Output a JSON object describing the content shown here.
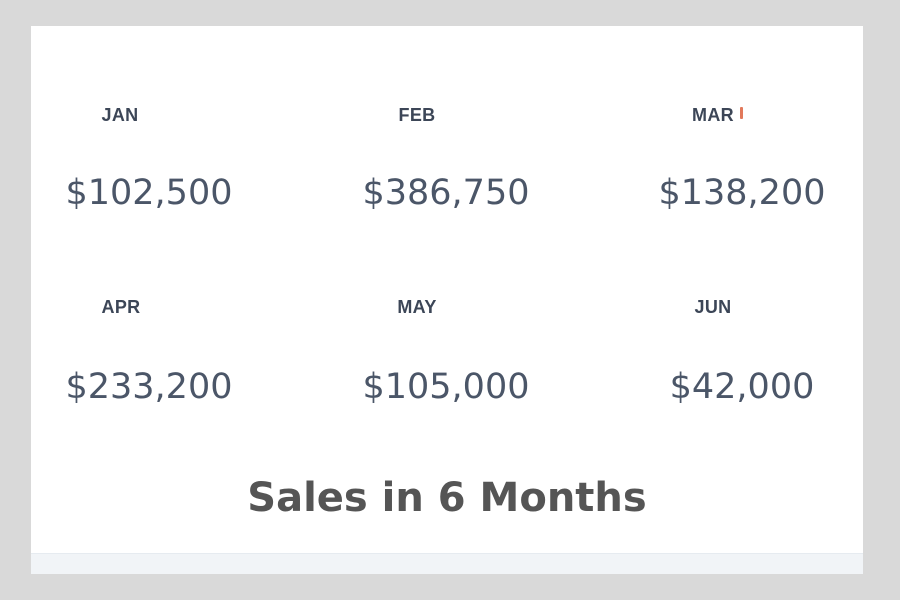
{
  "months": [
    {
      "label": "JAN",
      "value": "$102,500"
    },
    {
      "label": "FEB",
      "value": "$386,750"
    },
    {
      "label": "MAR",
      "value": "$138,200"
    },
    {
      "label": "APR",
      "value": "$233,200"
    },
    {
      "label": "MAY",
      "value": "$105,000"
    },
    {
      "label": "JUN",
      "value": "$42,000"
    }
  ],
  "caption": "Sales in 6 Months",
  "colors": {
    "background": "#d9d9d9",
    "card": "#ffffff",
    "label": "#3c4657",
    "value": "#4b5668",
    "caption": "#555555",
    "accent": "#e2795b"
  }
}
